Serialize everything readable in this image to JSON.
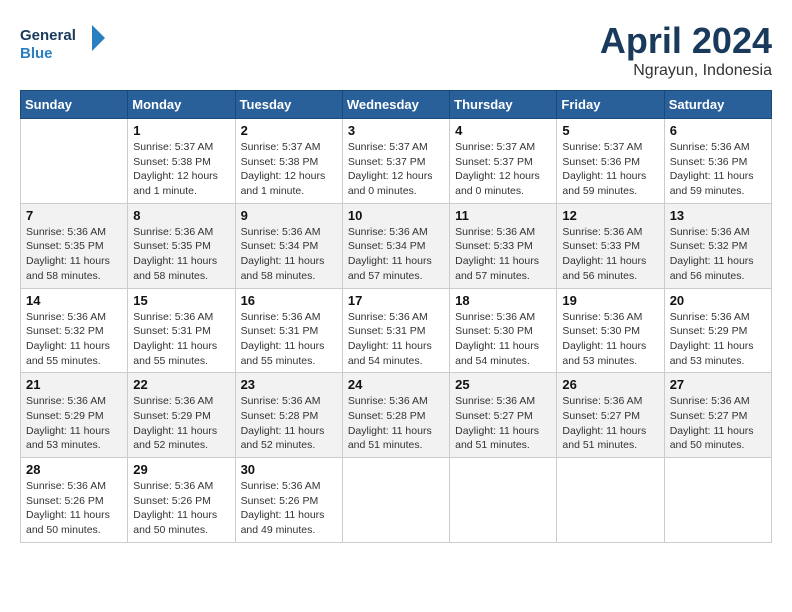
{
  "header": {
    "logo_line1": "General",
    "logo_line2": "Blue",
    "month": "April 2024",
    "location": "Ngrayun, Indonesia"
  },
  "columns": [
    "Sunday",
    "Monday",
    "Tuesday",
    "Wednesday",
    "Thursday",
    "Friday",
    "Saturday"
  ],
  "weeks": [
    [
      {
        "num": "",
        "info": ""
      },
      {
        "num": "1",
        "info": "Sunrise: 5:37 AM\nSunset: 5:38 PM\nDaylight: 12 hours\nand 1 minute."
      },
      {
        "num": "2",
        "info": "Sunrise: 5:37 AM\nSunset: 5:38 PM\nDaylight: 12 hours\nand 1 minute."
      },
      {
        "num": "3",
        "info": "Sunrise: 5:37 AM\nSunset: 5:37 PM\nDaylight: 12 hours\nand 0 minutes."
      },
      {
        "num": "4",
        "info": "Sunrise: 5:37 AM\nSunset: 5:37 PM\nDaylight: 12 hours\nand 0 minutes."
      },
      {
        "num": "5",
        "info": "Sunrise: 5:37 AM\nSunset: 5:36 PM\nDaylight: 11 hours\nand 59 minutes."
      },
      {
        "num": "6",
        "info": "Sunrise: 5:36 AM\nSunset: 5:36 PM\nDaylight: 11 hours\nand 59 minutes."
      }
    ],
    [
      {
        "num": "7",
        "info": "Sunrise: 5:36 AM\nSunset: 5:35 PM\nDaylight: 11 hours\nand 58 minutes."
      },
      {
        "num": "8",
        "info": "Sunrise: 5:36 AM\nSunset: 5:35 PM\nDaylight: 11 hours\nand 58 minutes."
      },
      {
        "num": "9",
        "info": "Sunrise: 5:36 AM\nSunset: 5:34 PM\nDaylight: 11 hours\nand 58 minutes."
      },
      {
        "num": "10",
        "info": "Sunrise: 5:36 AM\nSunset: 5:34 PM\nDaylight: 11 hours\nand 57 minutes."
      },
      {
        "num": "11",
        "info": "Sunrise: 5:36 AM\nSunset: 5:33 PM\nDaylight: 11 hours\nand 57 minutes."
      },
      {
        "num": "12",
        "info": "Sunrise: 5:36 AM\nSunset: 5:33 PM\nDaylight: 11 hours\nand 56 minutes."
      },
      {
        "num": "13",
        "info": "Sunrise: 5:36 AM\nSunset: 5:32 PM\nDaylight: 11 hours\nand 56 minutes."
      }
    ],
    [
      {
        "num": "14",
        "info": "Sunrise: 5:36 AM\nSunset: 5:32 PM\nDaylight: 11 hours\nand 55 minutes."
      },
      {
        "num": "15",
        "info": "Sunrise: 5:36 AM\nSunset: 5:31 PM\nDaylight: 11 hours\nand 55 minutes."
      },
      {
        "num": "16",
        "info": "Sunrise: 5:36 AM\nSunset: 5:31 PM\nDaylight: 11 hours\nand 55 minutes."
      },
      {
        "num": "17",
        "info": "Sunrise: 5:36 AM\nSunset: 5:31 PM\nDaylight: 11 hours\nand 54 minutes."
      },
      {
        "num": "18",
        "info": "Sunrise: 5:36 AM\nSunset: 5:30 PM\nDaylight: 11 hours\nand 54 minutes."
      },
      {
        "num": "19",
        "info": "Sunrise: 5:36 AM\nSunset: 5:30 PM\nDaylight: 11 hours\nand 53 minutes."
      },
      {
        "num": "20",
        "info": "Sunrise: 5:36 AM\nSunset: 5:29 PM\nDaylight: 11 hours\nand 53 minutes."
      }
    ],
    [
      {
        "num": "21",
        "info": "Sunrise: 5:36 AM\nSunset: 5:29 PM\nDaylight: 11 hours\nand 53 minutes."
      },
      {
        "num": "22",
        "info": "Sunrise: 5:36 AM\nSunset: 5:29 PM\nDaylight: 11 hours\nand 52 minutes."
      },
      {
        "num": "23",
        "info": "Sunrise: 5:36 AM\nSunset: 5:28 PM\nDaylight: 11 hours\nand 52 minutes."
      },
      {
        "num": "24",
        "info": "Sunrise: 5:36 AM\nSunset: 5:28 PM\nDaylight: 11 hours\nand 51 minutes."
      },
      {
        "num": "25",
        "info": "Sunrise: 5:36 AM\nSunset: 5:27 PM\nDaylight: 11 hours\nand 51 minutes."
      },
      {
        "num": "26",
        "info": "Sunrise: 5:36 AM\nSunset: 5:27 PM\nDaylight: 11 hours\nand 51 minutes."
      },
      {
        "num": "27",
        "info": "Sunrise: 5:36 AM\nSunset: 5:27 PM\nDaylight: 11 hours\nand 50 minutes."
      }
    ],
    [
      {
        "num": "28",
        "info": "Sunrise: 5:36 AM\nSunset: 5:26 PM\nDaylight: 11 hours\nand 50 minutes."
      },
      {
        "num": "29",
        "info": "Sunrise: 5:36 AM\nSunset: 5:26 PM\nDaylight: 11 hours\nand 50 minutes."
      },
      {
        "num": "30",
        "info": "Sunrise: 5:36 AM\nSunset: 5:26 PM\nDaylight: 11 hours\nand 49 minutes."
      },
      {
        "num": "",
        "info": ""
      },
      {
        "num": "",
        "info": ""
      },
      {
        "num": "",
        "info": ""
      },
      {
        "num": "",
        "info": ""
      }
    ]
  ]
}
